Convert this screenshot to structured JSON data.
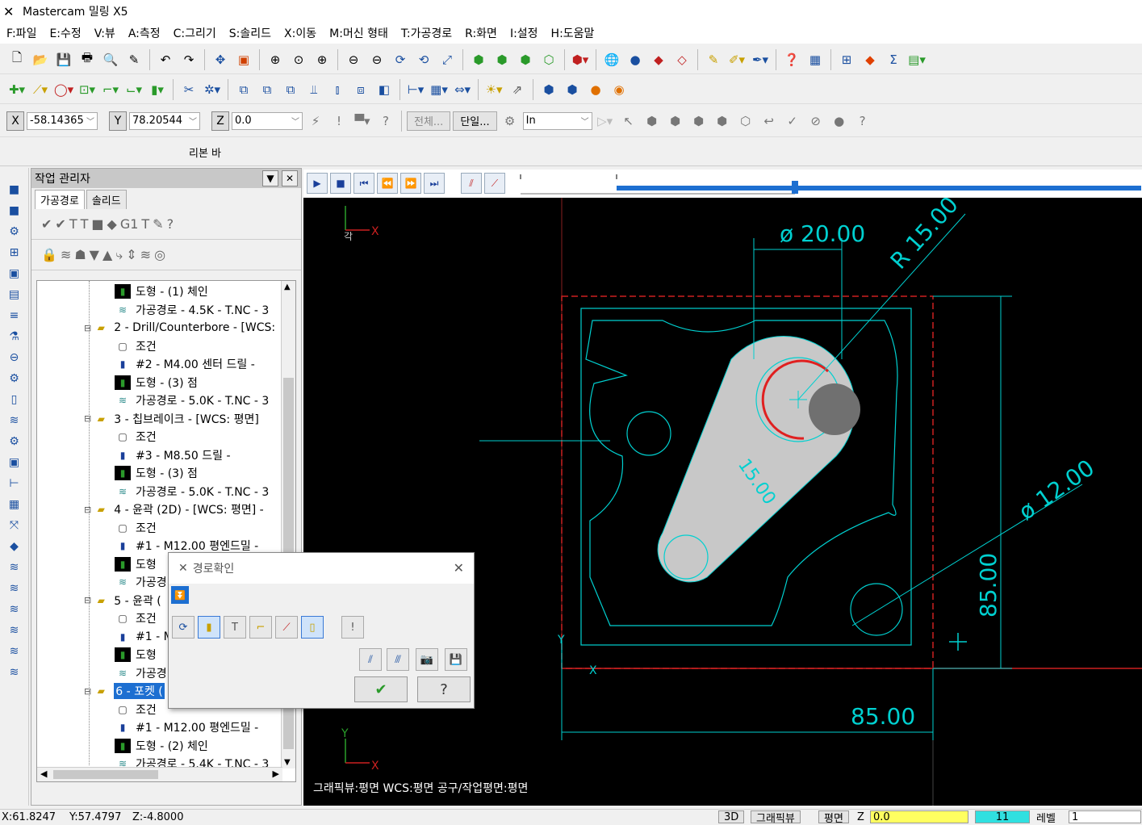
{
  "app": {
    "title": "Mastercam 밀링 X5"
  },
  "menu": [
    "F:파일",
    "E:수정",
    "V:뷰",
    "A:측정",
    "C:그리기",
    "S:솔리드",
    "X:이동",
    "M:머신 형태",
    "T:가공경로",
    "R:화면",
    "I:설정",
    "H:도움말"
  ],
  "coords": {
    "x_label": "X",
    "x_value": "-58.14365",
    "y_label": "Y",
    "y_value": "78.20544",
    "z_label": "Z",
    "z_value": "0.0",
    "all_btn": "전체...",
    "single_btn": "단일...",
    "unit": "In"
  },
  "ribbon": {
    "label": "리본 바"
  },
  "ops_manager": {
    "title": "작업 관리자",
    "tabs": [
      "가공경로",
      "솔리드"
    ],
    "nodes": [
      {
        "text": "도형 - (1) 체인",
        "indent": 2,
        "icon": "geometry"
      },
      {
        "text": "가공경로 - 4.5K - T.NC - 3",
        "indent": 2,
        "icon": "toolpath"
      },
      {
        "text": "2 - Drill/Counterbore - [WCS:",
        "indent": 1,
        "icon": "folder"
      },
      {
        "text": "조건",
        "indent": 2,
        "icon": "params"
      },
      {
        "text": "#2 - M4.00 센터 드릴 -",
        "indent": 2,
        "icon": "tool"
      },
      {
        "text": "도형 - (3) 점",
        "indent": 2,
        "icon": "geometry"
      },
      {
        "text": "가공경로 - 5.0K - T.NC - 3",
        "indent": 2,
        "icon": "toolpath"
      },
      {
        "text": "3 - 칩브레이크 - [WCS: 평면]",
        "indent": 1,
        "icon": "folder"
      },
      {
        "text": "조건",
        "indent": 2,
        "icon": "params"
      },
      {
        "text": "#3 - M8.50 드릴 -",
        "indent": 2,
        "icon": "tool"
      },
      {
        "text": "도형 - (3) 점",
        "indent": 2,
        "icon": "geometry"
      },
      {
        "text": "가공경로 - 5.0K - T.NC - 3",
        "indent": 2,
        "icon": "toolpath"
      },
      {
        "text": "4 - 윤곽 (2D) - [WCS: 평면] -",
        "indent": 1,
        "icon": "folder"
      },
      {
        "text": "조건",
        "indent": 2,
        "icon": "params"
      },
      {
        "text": "#1 - M12.00 평엔드밀 -",
        "indent": 2,
        "icon": "tool"
      },
      {
        "text": "도형",
        "indent": 2,
        "icon": "geometry"
      },
      {
        "text": "가공경",
        "indent": 2,
        "icon": "toolpath"
      },
      {
        "text": "5 - 윤곽 (",
        "indent": 1,
        "icon": "folder"
      },
      {
        "text": "조건",
        "indent": 2,
        "icon": "params"
      },
      {
        "text": "#1 - M",
        "indent": 2,
        "icon": "tool"
      },
      {
        "text": "도형",
        "indent": 2,
        "icon": "geometry"
      },
      {
        "text": "가공경",
        "indent": 2,
        "icon": "toolpath"
      },
      {
        "text": "6 - 포켓 (",
        "indent": 1,
        "icon": "folder",
        "selected": true
      },
      {
        "text": "조건",
        "indent": 2,
        "icon": "params"
      },
      {
        "text": "#1 - M12.00 평엔드밀 -",
        "indent": 2,
        "icon": "tool"
      },
      {
        "text": "도형 - (2) 체인",
        "indent": 2,
        "icon": "geometry"
      },
      {
        "text": "가공경로 - 5.4K - T.NC - 3",
        "indent": 2,
        "icon": "toolpath"
      }
    ]
  },
  "dialog": {
    "title": "경로확인"
  },
  "viewport": {
    "dims": {
      "dia20": "ø 20.00",
      "r15": "R 15.00",
      "dia12": "ø 12.00",
      "h85": "85.00",
      "w85": "85.00",
      "slot": "15.00"
    },
    "axis_x": "X",
    "axis_y": "Y",
    "status_text": "그래픽뷰:평면   WCS:평면   공구/작업평면:평면",
    "colors": {
      "cyan": "#00e0e0",
      "red": "#e02020",
      "part_fill": "#c8c8c8"
    }
  },
  "statusbar": {
    "x": "X:61.8247",
    "y": "Y:57.4797",
    "z": "Z:-4.8000",
    "mode3d": "3D",
    "graphic_view": "그래픽뷰",
    "plane": "평면",
    "z_label": "Z",
    "z_val": "0.0",
    "level_num": "11",
    "level_label": "레벨",
    "level_val": "1"
  }
}
